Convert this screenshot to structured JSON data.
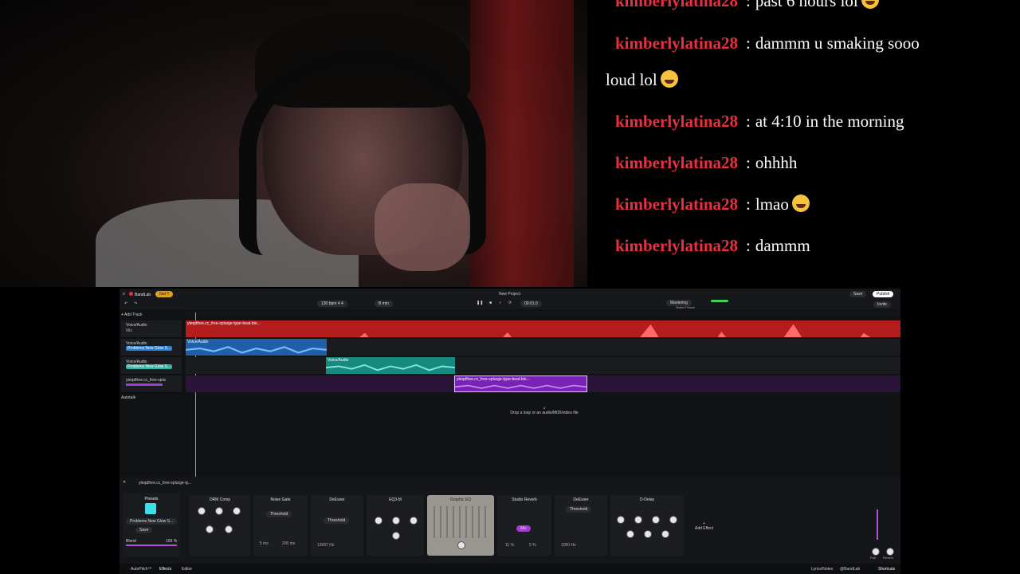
{
  "chat": {
    "messages": [
      {
        "user": "kimberlylatina28",
        "text": "past 6 hours lol",
        "emoji": true
      },
      {
        "user": "kimberlylatina28",
        "text": "dammm u smaking sooo",
        "continuation": "loud lol",
        "emoji": true
      },
      {
        "user": "kimberlylatina28",
        "text": "at 4:10 in the morning",
        "emoji": false
      },
      {
        "user": "kimberlylatina28",
        "text": "ohhhh",
        "emoji": false
      },
      {
        "user": "kimberlylatina28",
        "text": "lmao",
        "emoji": true
      },
      {
        "user": "kimberlylatina28",
        "text": "dammm",
        "emoji": false
      }
    ],
    "separator": ":"
  },
  "daw": {
    "app_name": "BandLab",
    "badge": "Get ‼",
    "project_title": "New Project",
    "tempo": "130",
    "tempo_unit": "bpm",
    "time_sig": "4 4",
    "key": "B min",
    "timecode": "00:01.0",
    "mastering_label": "Mastering",
    "mastering_sub": "Select Preset",
    "save_label": "Save",
    "publish_label": "Publish",
    "invite_label": "Invite",
    "add_track_label": "Add Track",
    "autopitch_label": "Autotalk",
    "drop_hint": "Drop a loop or an audio/MIDI/video file",
    "tracks": [
      {
        "name": "Voice/Audio",
        "color": "#e23b3b",
        "sub": "Mix"
      },
      {
        "name": "Voice/Audio",
        "color": "#2f7fcf",
        "sub": "Problems New Glow S..."
      },
      {
        "name": "Voice/Audio",
        "color": "#2fb3a8",
        "sub": "Problems New Glow S..."
      },
      {
        "name": "yteqdfree.cc_free-splurge-typ...",
        "color": "#9b3fd6",
        "sub": ""
      }
    ],
    "clips": [
      {
        "label": "yteqdfree.cc_free-splurge-type-beat-blo...",
        "color": "#d42828"
      },
      {
        "label": "Voice/Audio",
        "color": "#2a6fc0"
      },
      {
        "label": "Voice/Audio",
        "color": "#1f9e94"
      },
      {
        "label": "yteqdfree.cc_free-splurge-type-beat-blo...",
        "color": "#8a2bc9"
      }
    ]
  },
  "fx": {
    "track_label": "yteqdfree.cc_free-splurge-ty...",
    "presets_label": "Presets",
    "preset_name": "Problems New Glow S...",
    "save_label": "Save",
    "blend_label": "Blend",
    "blend_value": "100 %",
    "add_effect_label": "Add Effect",
    "volume_label": "Volume",
    "pan_label": "Pan",
    "reverb_label": "Reverb",
    "cards": [
      {
        "title": "DRM Comp",
        "values": [
          "Attack",
          "Release",
          "Threshold",
          "Ratio",
          "Knee"
        ]
      },
      {
        "title": "Noise Gate",
        "values": [
          "Threshold",
          "5 ms",
          "200 ms"
        ],
        "extra": [
          "Attack",
          "Release"
        ]
      },
      {
        "title": "DeEsser",
        "values": [
          "Threshold",
          "13997 Hz"
        ],
        "extra": [
          "Frequency"
        ]
      },
      {
        "title": "EQ3-M",
        "values": [
          "Low",
          "Mid",
          "High",
          "Mid Freq"
        ]
      },
      {
        "title": "Graphic EQ",
        "values": [
          "Level"
        ]
      },
      {
        "title": "Studio Reverb",
        "values": [
          "Mix",
          "11 %",
          "5 %"
        ],
        "extra": [
          "Size",
          "Damp"
        ]
      },
      {
        "title": "DeEsser",
        "values": [
          "Threshold",
          "1000 Hz"
        ],
        "extra": [
          "Frequency"
        ]
      },
      {
        "title": "D-Delay",
        "values": [
          "Time",
          "Feedback",
          "High Pass",
          "Low Pass",
          "Dry Level",
          "Wet Level",
          "Volume"
        ]
      }
    ],
    "bottom_tabs": [
      "AutoPitch™",
      "Effects",
      "Editor"
    ],
    "bottom_right": [
      "Lyrics/Notes",
      "@BandLab",
      "Shortcuts"
    ]
  },
  "colors": {
    "accent": "#e0353a",
    "chat_user": "#e8303f",
    "cyan": "#3de0e6"
  }
}
